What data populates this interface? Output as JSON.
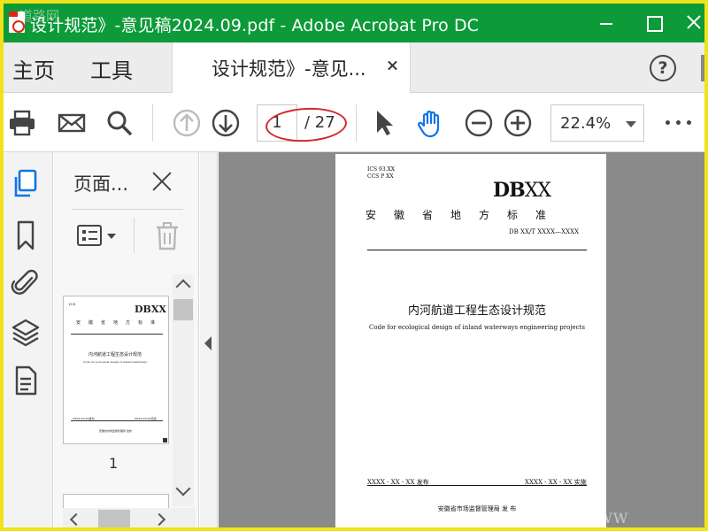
{
  "window": {
    "title": "设计规范》-意见稿2024.09.pdf - Adobe Acrobat Pro DC",
    "watermark_top": "道路网",
    "watermark_bottom": "WWW"
  },
  "menu": {
    "home": "主页",
    "tools": "工具"
  },
  "tab": {
    "label": "设计规范》-意见..."
  },
  "toolbar": {
    "page_current": "1",
    "page_total": "/ 27",
    "zoom": "22.4%",
    "annotation_color": "#d3282a"
  },
  "panel": {
    "title": "页面...",
    "thumbnail_page_number": "1"
  },
  "document": {
    "ics": "ICS  93.XX",
    "ccs": "CCS  P XX",
    "logo_db": "DB",
    "logo_xx": "XX",
    "province": "安徽省地方标准",
    "code": "DB XX/T  XXXX—XXXX",
    "title": "内河航道工程生态设计规范",
    "subtitle": "Code for ecological design of inland waterways engineering projects",
    "issue": "XXXX - XX - XX 发布",
    "implement": "XXXX - XX - XX 实施",
    "publisher": "安徽省市场监督管理局      发  布"
  },
  "colors": {
    "titlebar": "#0d9a38",
    "frame": "#f2e21b",
    "accent_blue": "#1473e6",
    "viewport": "#8a8a8a"
  }
}
